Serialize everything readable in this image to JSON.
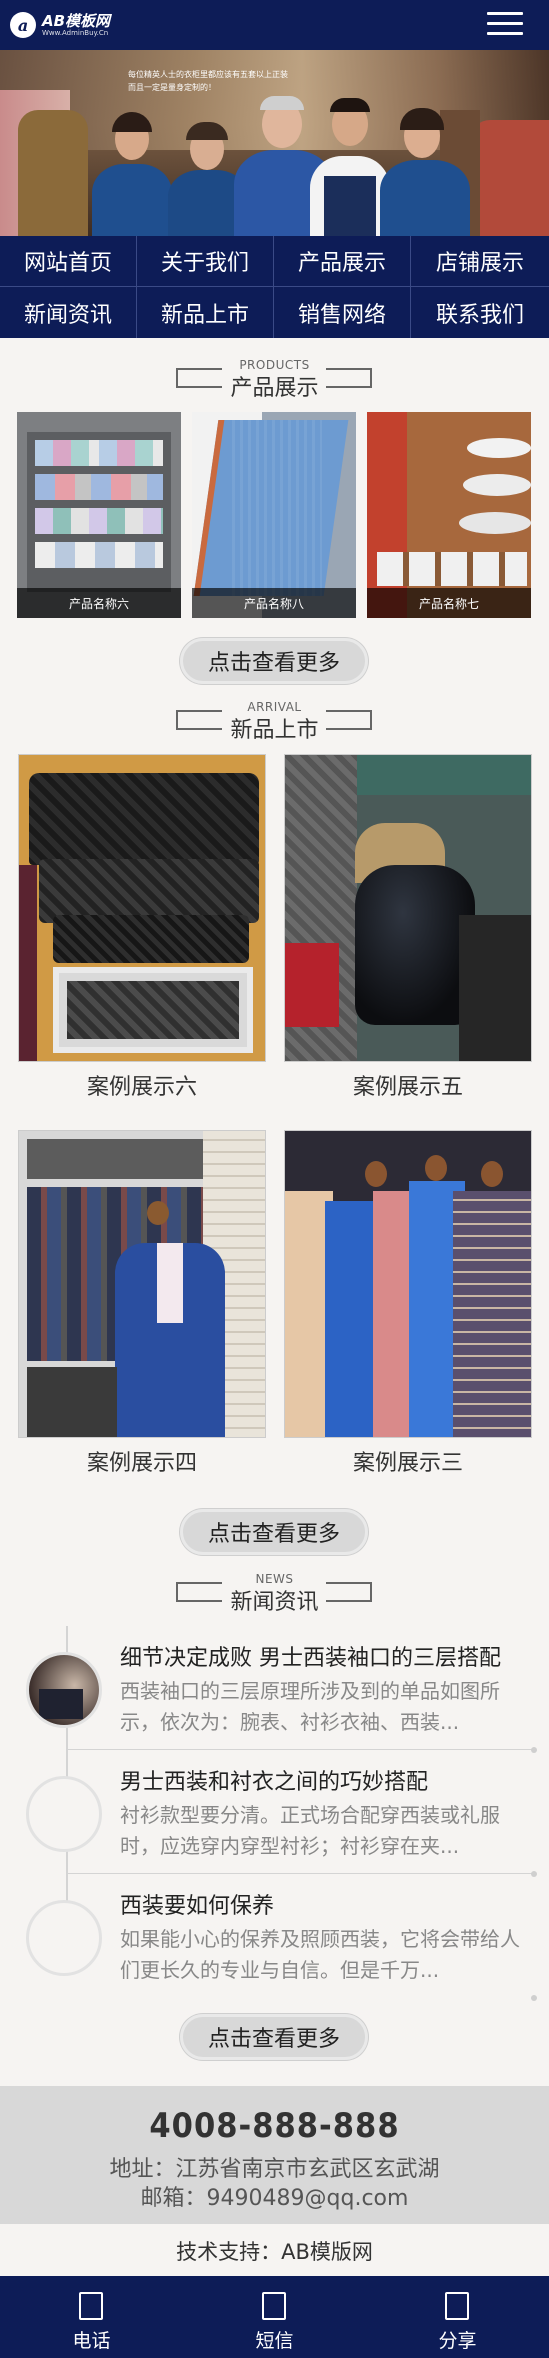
{
  "header": {
    "logo_title": "AB模板网",
    "logo_subtitle": "Www.AdminBuy.Cn",
    "logo_mark": "a",
    "menu_icon": "hamburger-menu-icon"
  },
  "banner": {
    "caption": "每位精英人士的衣柜里都应该有五套以上正装\n而且一定是量身定制的！"
  },
  "nav": [
    {
      "label": "网站首页"
    },
    {
      "label": "关于我们"
    },
    {
      "label": "产品展示"
    },
    {
      "label": "店铺展示"
    },
    {
      "label": "新闻资讯"
    },
    {
      "label": "新品上市"
    },
    {
      "label": "销售网络"
    },
    {
      "label": "联系我们"
    }
  ],
  "products": {
    "title_en": "PRODUCTS",
    "title_zh": "产品展示",
    "items": [
      {
        "name": "产品名称六"
      },
      {
        "name": "产品名称八"
      },
      {
        "name": "产品名称七"
      }
    ],
    "more_label": "点击查看更多"
  },
  "arrival": {
    "title_en": "ARRIVAL",
    "title_zh": "新品上市",
    "items": [
      {
        "name": "案例展示六"
      },
      {
        "name": "案例展示五"
      },
      {
        "name": "案例展示四"
      },
      {
        "name": "案例展示三"
      }
    ],
    "more_label": "点击查看更多"
  },
  "news": {
    "title_en": "NEWS",
    "title_zh": "新闻资讯",
    "items": [
      {
        "title": "细节决定成败 男士西装袖口的三层搭配",
        "desc": "西装袖口的三层原理所涉及到的单品如图所示，依次为：腕表、衬衫衣袖、西装..."
      },
      {
        "title": "男士西装和衬衣之间的巧妙搭配",
        "desc": "衬衫款型要分清。正式场合配穿西装或礼服时，应选穿内穿型衬衫；衬衫穿在夹..."
      },
      {
        "title": "西装要如何保养",
        "desc": "如果能小心的保养及照顾西装，它将会带给人们更长久的专业与自信。但是千万..."
      }
    ],
    "more_label": "点击查看更多"
  },
  "contact": {
    "phone": "4008-888-888",
    "address": "地址：江苏省南京市玄武区玄武湖",
    "email": "邮箱：9490489@qq.com",
    "support": "技术支持：AB模版网"
  },
  "bottombar": [
    {
      "label": "电话",
      "icon": "phone-icon"
    },
    {
      "label": "短信",
      "icon": "message-icon"
    },
    {
      "label": "分享",
      "icon": "share-icon"
    }
  ]
}
